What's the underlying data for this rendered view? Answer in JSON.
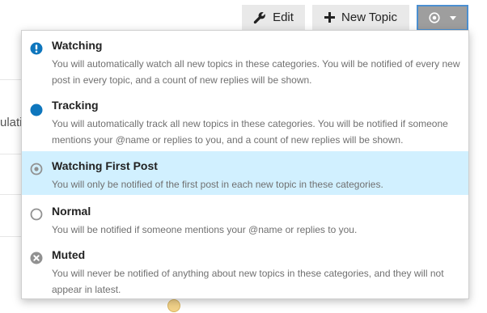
{
  "toolbar": {
    "edit_label": "Edit",
    "new_topic_label": "New Topic",
    "notification_icon": "circle-dot-icon",
    "caret_icon": "caret-down-icon"
  },
  "background": {
    "partial_text": "ulati"
  },
  "notification_menu": {
    "options": [
      {
        "title": "Watching",
        "description": "You will automatically watch all new topics in these categories. You will be notified of every new post in every topic, and a count of new replies will be shown.",
        "icon": "exclamation-circle-icon",
        "icon_color": "#0e76bd",
        "selected": false
      },
      {
        "title": "Tracking",
        "description": "You will automatically track all new topics in these categories. You will be notified if someone mentions your @name or replies to you, and a count of new replies will be shown.",
        "icon": "filled-circle-icon",
        "icon_color": "#0e76bd",
        "selected": false
      },
      {
        "title": "Watching First Post",
        "description": "You will only be notified of the first post in each new topic in these categories.",
        "icon": "dot-circle-icon",
        "icon_color": "#919191",
        "selected": true
      },
      {
        "title": "Normal",
        "description": "You will be notified if someone mentions your @name or replies to you.",
        "icon": "empty-circle-icon",
        "icon_color": "#919191",
        "selected": false
      },
      {
        "title": "Muted",
        "description": "You will never be notified of anything about new topics in these categories, and they will not appear in latest.",
        "icon": "times-circle-icon",
        "icon_color": "#919191",
        "selected": false
      }
    ]
  },
  "colors": {
    "selected_bg": "#d1f0ff",
    "button_bg": "#e9e9e9",
    "active_button_bg": "#9e9e9e",
    "focus_border": "#4b8fd1"
  }
}
